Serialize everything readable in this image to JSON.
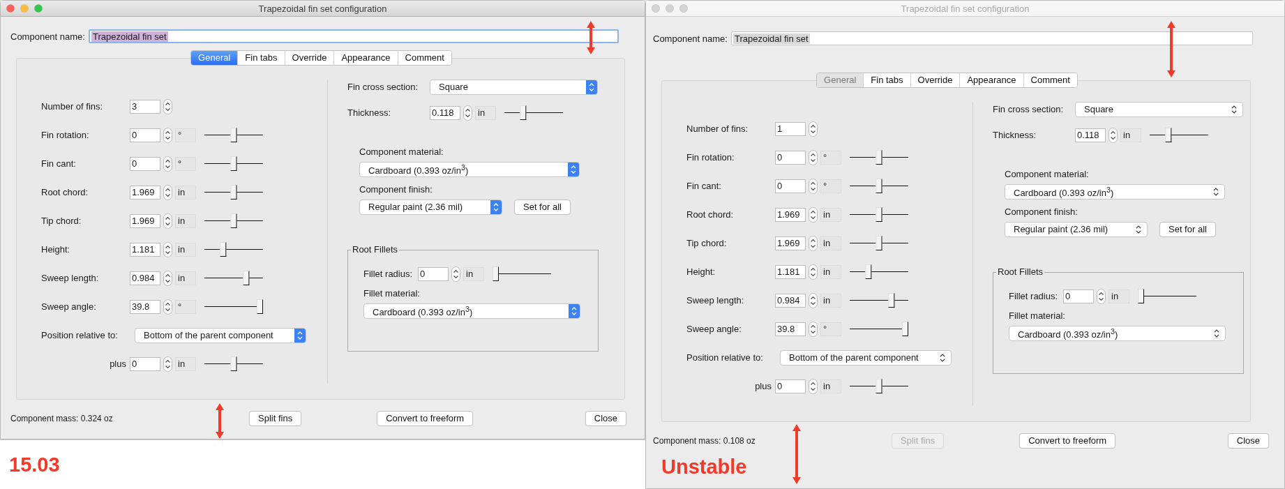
{
  "windows": [
    {
      "title": "Trapezoidal fin set configuration",
      "active": true,
      "name_label": "Component name:",
      "name_value": "Trapezoidal fin set",
      "tabs": [
        {
          "label": "General",
          "selected": true
        },
        {
          "label": "Fin tabs",
          "selected": false
        },
        {
          "label": "Override",
          "selected": false
        },
        {
          "label": "Appearance",
          "selected": false
        },
        {
          "label": "Comment",
          "selected": false
        }
      ],
      "rows": [
        {
          "kind": "number",
          "label": "Number of fins:",
          "value": "3"
        },
        {
          "kind": "number",
          "label": "Fin rotation:",
          "value": "0",
          "unit": "°",
          "level": 0.5
        },
        {
          "kind": "number",
          "label": "Fin cant:",
          "value": "0",
          "unit": "°",
          "level": 0.5
        },
        {
          "kind": "number",
          "label": "Root chord:",
          "value": "1.969",
          "unit": "in",
          "level": 0.5
        },
        {
          "kind": "number",
          "label": "Tip chord:",
          "value": "1.969",
          "unit": "in",
          "level": 0.5
        },
        {
          "kind": "number",
          "label": "Height:",
          "value": "1.181",
          "unit": "in",
          "level": 0.3
        },
        {
          "kind": "number",
          "label": "Sweep length:",
          "value": "0.984",
          "unit": "in",
          "level": 0.74
        },
        {
          "kind": "number",
          "label": "Sweep angle:",
          "value": "39.8",
          "unit": "°",
          "level": 1
        },
        {
          "kind": "dropdown",
          "label": "Position relative to:",
          "value": "Bottom of the parent component"
        },
        {
          "kind": "offset",
          "label": "plus",
          "value": "0",
          "unit": "in",
          "level": 0.5
        }
      ],
      "cross_section": {
        "label": "Fin cross section:",
        "value": "Square"
      },
      "thickness": {
        "label": "Thickness:",
        "value": "0.118",
        "unit": "in",
        "level": 0.3
      },
      "material": {
        "label": "Component material:",
        "value": "Cardboard (0.393 oz/in$^{3}$)"
      },
      "finish": {
        "label": "Component finish:",
        "value": "Regular paint (2.36 mil)",
        "button": "Set for all"
      },
      "fillets": {
        "title": "Root Fillets",
        "radius": {
          "label": "Fillet radius:",
          "value": "0",
          "unit": "in",
          "level": 0
        },
        "material": {
          "label": "Fillet material:",
          "value": "Cardboard (0.393 oz/in$^{3}$)"
        }
      },
      "mass": "Component mass: 0.324 oz",
      "buttons": [
        {
          "label": "Split fins",
          "disabled": false
        },
        {
          "label": "Convert to freeform",
          "disabled": false
        },
        {
          "label": "Close",
          "disabled": false
        }
      ],
      "result": {
        "text": "15.03",
        "kind": "below"
      }
    },
    {
      "title": "Trapezoidal fin set configuration",
      "active": false,
      "name_label": "Component name:",
      "name_value": "Trapezoidal fin set",
      "tabs": [
        {
          "label": "General",
          "selected": true
        },
        {
          "label": "Fin tabs",
          "selected": false
        },
        {
          "label": "Override",
          "selected": false
        },
        {
          "label": "Appearance",
          "selected": false
        },
        {
          "label": "Comment",
          "selected": false
        }
      ],
      "rows": [
        {
          "kind": "number",
          "label": "Number of fins:",
          "value": "1"
        },
        {
          "kind": "number",
          "label": "Fin rotation:",
          "value": "0",
          "unit": "°",
          "level": 0.5
        },
        {
          "kind": "number",
          "label": "Fin cant:",
          "value": "0",
          "unit": "°",
          "level": 0.5
        },
        {
          "kind": "number",
          "label": "Root chord:",
          "value": "1.969",
          "unit": "in",
          "level": 0.5
        },
        {
          "kind": "number",
          "label": "Tip chord:",
          "value": "1.969",
          "unit": "in",
          "level": 0.5
        },
        {
          "kind": "number",
          "label": "Height:",
          "value": "1.181",
          "unit": "in",
          "level": 0.3
        },
        {
          "kind": "number",
          "label": "Sweep length:",
          "value": "0.984",
          "unit": "in",
          "level": 0.74
        },
        {
          "kind": "number",
          "label": "Sweep angle:",
          "value": "39.8",
          "unit": "°",
          "level": 1
        },
        {
          "kind": "dropdown",
          "label": "Position relative to:",
          "value": "Bottom of the parent component"
        },
        {
          "kind": "offset",
          "label": "plus",
          "value": "0",
          "unit": "in",
          "level": 0.5
        }
      ],
      "cross_section": {
        "label": "Fin cross section:",
        "value": "Square"
      },
      "thickness": {
        "label": "Thickness:",
        "value": "0.118",
        "unit": "in",
        "level": 0.3
      },
      "material": {
        "label": "Component material:",
        "value": "Cardboard (0.393 oz/in$^{3}$)"
      },
      "finish": {
        "label": "Component finish:",
        "value": "Regular paint (2.36 mil)",
        "button": "Set for all"
      },
      "fillets": {
        "title": "Root Fillets",
        "radius": {
          "label": "Fillet radius:",
          "value": "0",
          "unit": "in",
          "level": 0
        },
        "material": {
          "label": "Fillet material:",
          "value": "Cardboard (0.393 oz/in$^{3}$)"
        }
      },
      "mass": "Component mass: 0.108 oz",
      "buttons": [
        {
          "label": "Split fins",
          "disabled": true
        },
        {
          "label": "Convert to freeform",
          "disabled": false
        },
        {
          "label": "Close",
          "disabled": false
        }
      ],
      "result": {
        "text": "Unstable",
        "kind": "overlay"
      }
    }
  ]
}
